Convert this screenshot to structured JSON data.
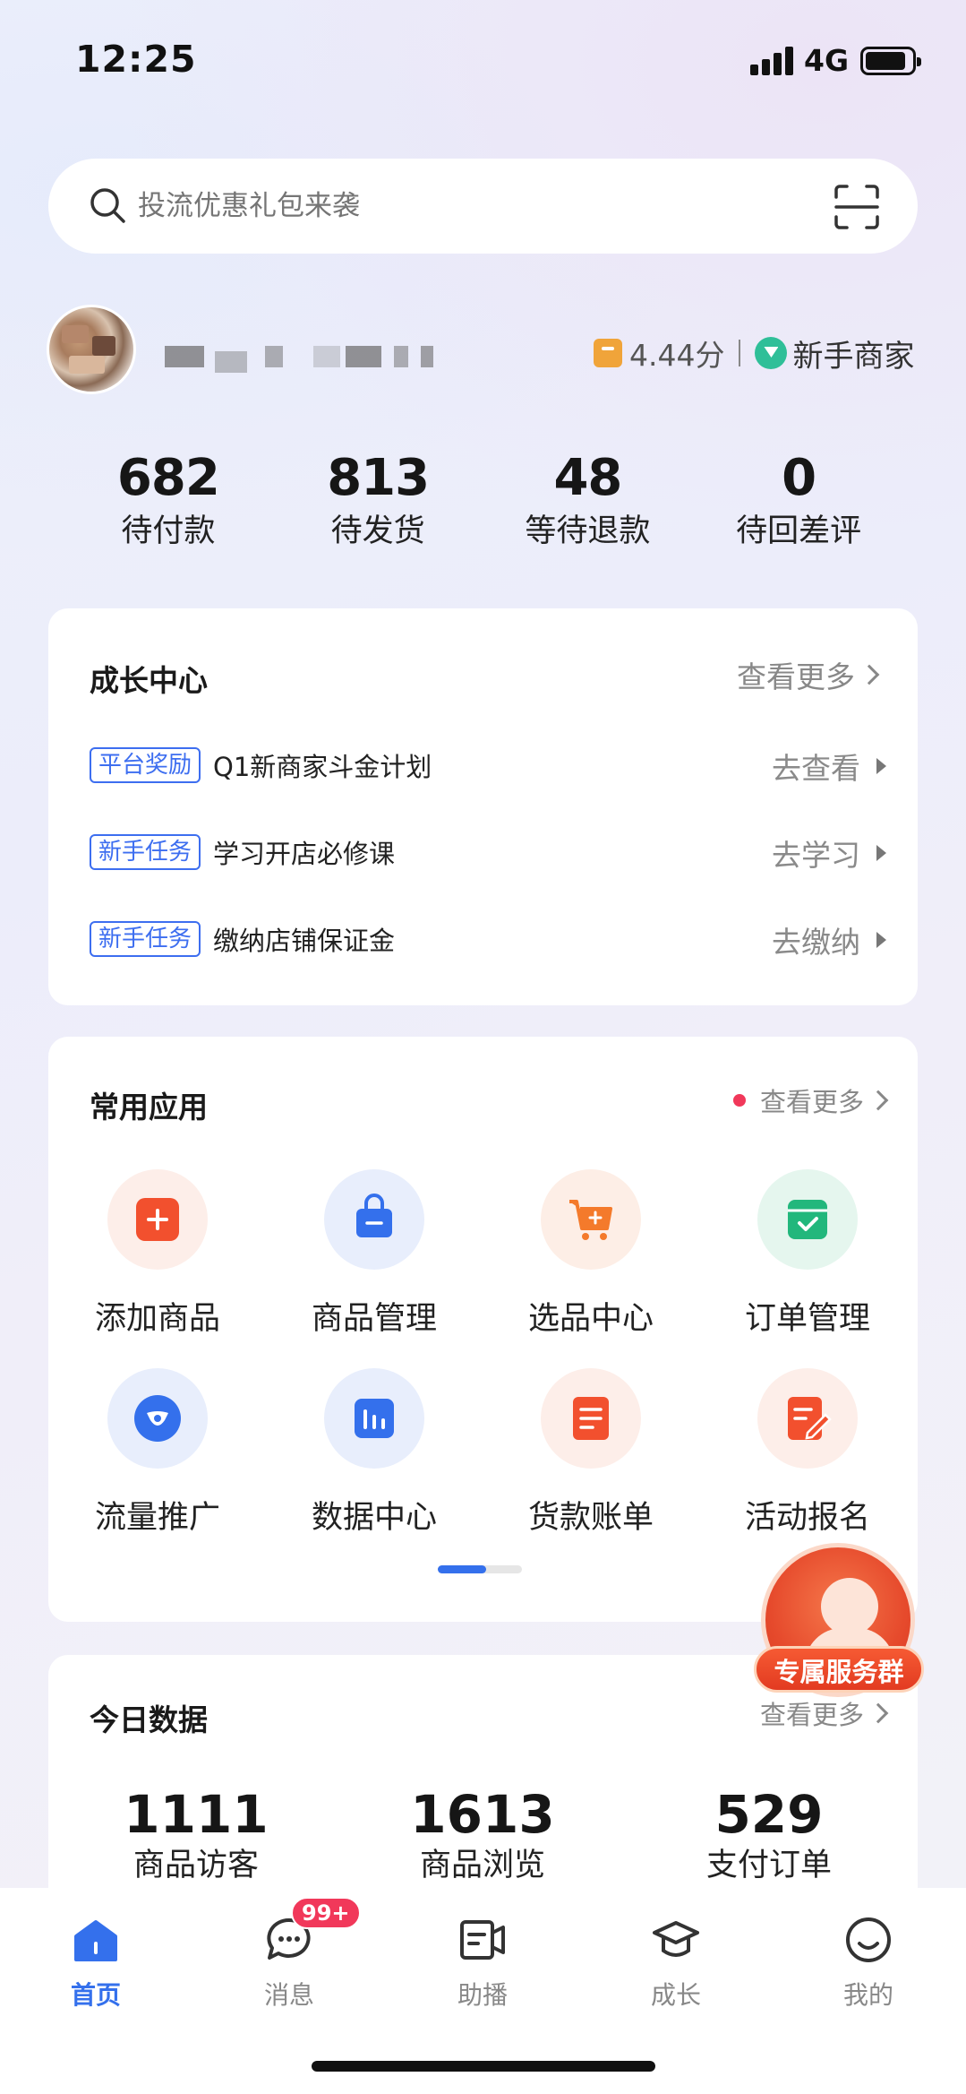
{
  "status_bar": {
    "time": "12:25",
    "network": "4G"
  },
  "search": {
    "placeholder": "投流优惠礼包来袭"
  },
  "shop": {
    "score": "4.44分",
    "level": "新手商家"
  },
  "stats": [
    {
      "value": "682",
      "label": "待付款"
    },
    {
      "value": "813",
      "label": "待发货"
    },
    {
      "value": "48",
      "label": "等待退款"
    },
    {
      "value": "0",
      "label": "待回差评"
    }
  ],
  "growth": {
    "title": "成长中心",
    "more": "查看更多",
    "items": [
      {
        "tag": "平台奖励",
        "text": "Q1新商家斗金计划",
        "action": "去查看"
      },
      {
        "tag": "新手任务",
        "text": "学习开店必修课",
        "action": "去学习"
      },
      {
        "tag": "新手任务",
        "text": "缴纳店铺保证金",
        "action": "去缴纳"
      }
    ]
  },
  "apps": {
    "title": "常用应用",
    "more": "查看更多",
    "items": [
      {
        "label": "添加商品",
        "icon": "add-product-icon",
        "color": "#f2502e",
        "bg": "#fdeee9"
      },
      {
        "label": "商品管理",
        "icon": "shopping-bag-icon",
        "color": "#3470ec",
        "bg": "#e8eefc"
      },
      {
        "label": "选品中心",
        "icon": "cart-icon",
        "color": "#f47a2b",
        "bg": "#fdeee6"
      },
      {
        "label": "订单管理",
        "icon": "order-check-icon",
        "color": "#22b77c",
        "bg": "#e5f6ee"
      },
      {
        "label": "流量推广",
        "icon": "traffic-icon",
        "color": "#3470ec",
        "bg": "#e8eefc"
      },
      {
        "label": "数据中心",
        "icon": "bar-chart-icon",
        "color": "#3470ec",
        "bg": "#e8eefc"
      },
      {
        "label": "货款账单",
        "icon": "bill-icon",
        "color": "#f2502e",
        "bg": "#fdeee9"
      },
      {
        "label": "活动报名",
        "icon": "signup-edit-icon",
        "color": "#f2502e",
        "bg": "#fdeee9"
      }
    ]
  },
  "service": {
    "label": "专属服务群"
  },
  "today": {
    "title": "今日数据",
    "more": "查看更多",
    "items": [
      {
        "value": "1111",
        "label": "商品访客"
      },
      {
        "value": "1613",
        "label": "商品浏览"
      },
      {
        "value": "529",
        "label": "支付订单"
      }
    ]
  },
  "tabs": [
    {
      "label": "首页",
      "icon": "home-icon",
      "active": true
    },
    {
      "label": "消息",
      "icon": "message-icon",
      "badge": "99+"
    },
    {
      "label": "助播",
      "icon": "assist-broadcast-icon"
    },
    {
      "label": "成长",
      "icon": "graduation-cap-icon"
    },
    {
      "label": "我的",
      "icon": "profile-smile-icon"
    }
  ],
  "colors": {
    "accent": "#3470ec",
    "badge": "#f1385a",
    "tag": "#3d6ef0"
  }
}
